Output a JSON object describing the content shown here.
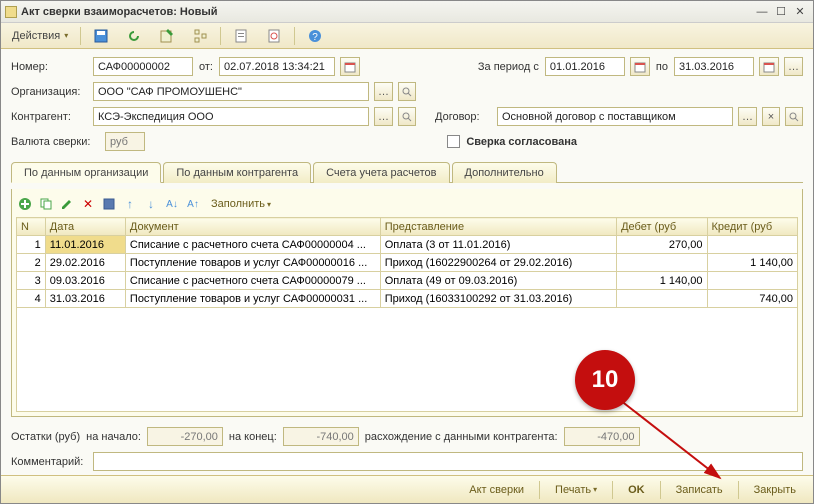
{
  "window": {
    "title": "Акт сверки взаиморасчетов: Новый"
  },
  "toolbar": {
    "actions": "Действия"
  },
  "header": {
    "number_label": "Номер:",
    "number": "САФ00000002",
    "ot": "от:",
    "datetime": "02.07.2018 13:34:21",
    "period_label": "За период с",
    "period_from": "01.01.2016",
    "po": "по",
    "period_to": "31.03.2016",
    "org_label": "Организация:",
    "org": "ООО \"САФ ПРОМОУШЕНС\"",
    "contr_label": "Контрагент:",
    "contr": "КСЭ-Экспедиция ООО",
    "dog_label": "Договор:",
    "dog": "Основной договор с поставщиком",
    "curr_label": "Валюта сверки:",
    "curr": "руб",
    "agree_label": "Сверка согласована"
  },
  "tabs": {
    "t1": "По данным организации",
    "t2": "По данным контрагента",
    "t3": "Счета учета расчетов",
    "t4": "Дополнительно"
  },
  "grid": {
    "fill": "Заполнить",
    "cols": {
      "n": "N",
      "date": "Дата",
      "doc": "Документ",
      "repr": "Представление",
      "deb": "Дебет (руб",
      "cred": "Кредит (руб"
    },
    "rows": [
      {
        "n": "1",
        "date": "11.01.2016",
        "doc": "Списание с расчетного счета САФ00000004 ...",
        "repr": "Оплата (3 от 11.01.2016)",
        "deb": "270,00",
        "cred": ""
      },
      {
        "n": "2",
        "date": "29.02.2016",
        "doc": "Поступление товаров и услуг САФ00000016 ...",
        "repr": "Приход (16022900264 от 29.02.2016)",
        "deb": "",
        "cred": "1 140,00"
      },
      {
        "n": "3",
        "date": "09.03.2016",
        "doc": "Списание с расчетного счета САФ00000079 ...",
        "repr": "Оплата (49 от 09.03.2016)",
        "deb": "1 140,00",
        "cred": ""
      },
      {
        "n": "4",
        "date": "31.03.2016",
        "doc": "Поступление товаров и услуг САФ00000031 ...",
        "repr": "Приход (16033100292 от 31.03.2016)",
        "deb": "",
        "cred": "740,00"
      }
    ]
  },
  "totals": {
    "balance_label": "Остатки (руб)",
    "start_label": "на начало:",
    "start": "-270,00",
    "end_label": "на конец:",
    "end": "-740,00",
    "diff_label": "расхождение с данными контрагента:",
    "diff": "-470,00"
  },
  "comment_label": "Комментарий:",
  "footer": {
    "act": "Акт сверки",
    "print": "Печать",
    "ok": "OK",
    "save": "Записать",
    "close": "Закрыть"
  },
  "annotation": {
    "num": "10"
  }
}
